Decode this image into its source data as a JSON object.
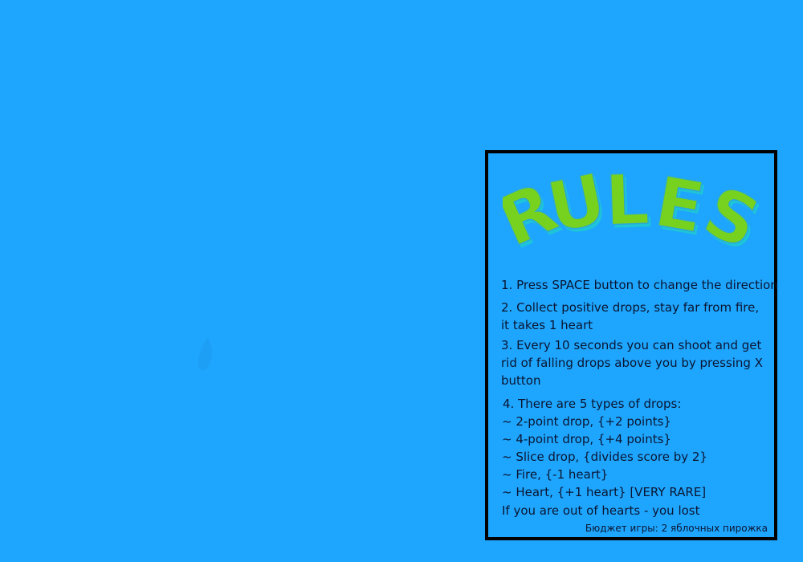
{
  "colors": {
    "background": "#1ea6ff",
    "panel_border": "#000000",
    "title_fill": "#76d21e",
    "title_shadow": "#1ec4d8",
    "text": "#0b1530"
  },
  "title_art_text": "RULES",
  "rules": {
    "rule1": "1. Press SPACE button to change the direction",
    "rule2_line1": "2. Collect positive drops, stay far from fire,",
    "rule2_line2": "it takes 1 heart",
    "rule3_line1": "3. Every 10 seconds you can shoot and get",
    "rule3_line2": "rid of falling drops above you by pressing X",
    "rule3_line3": "button",
    "rule4_header": "4. There are 5 types of drops:",
    "drop_types": [
      "~ 2-point drop, {+2 points}",
      "~ 4-point drop, {+4 points}",
      "~ Slice drop, {divides score by 2}",
      "~ Fire, {-1 heart}",
      "~ Heart, {+1 heart} [VERY RARE]"
    ],
    "lose_note": "If you are out of hearts - you lost",
    "budget": "Бюджет игры: 2 яблочных пирожка"
  }
}
